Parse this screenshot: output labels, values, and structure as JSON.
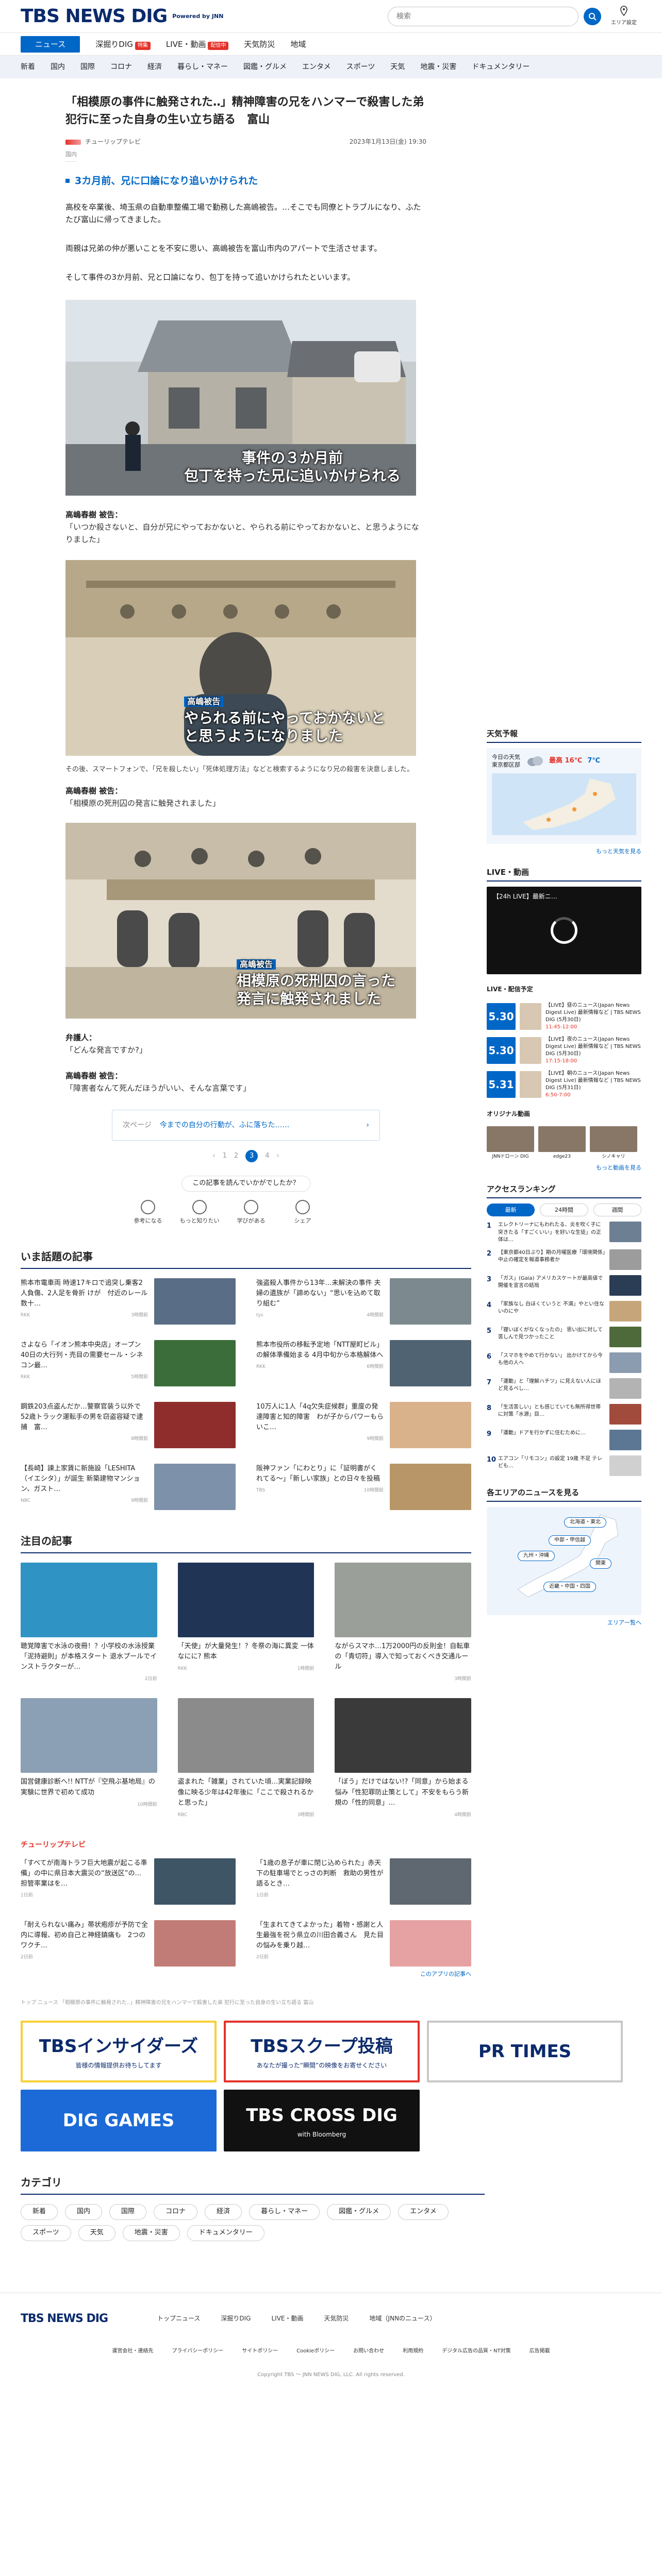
{
  "header": {
    "logo": "TBS NEWS DIG",
    "logo_sub": "Powered by JNN",
    "search_placeholder": "検索",
    "area_label": "エリア設定"
  },
  "subnav": [
    {
      "label": "ニュース",
      "active": true
    },
    {
      "label": "深掘りDIG",
      "badge": "特集"
    },
    {
      "label": "LIVE・動画",
      "badge": "配信中"
    },
    {
      "label": "天気防災"
    },
    {
      "label": "地域"
    }
  ],
  "categories_nav": [
    "新着",
    "国内",
    "国際",
    "コロナ",
    "経済",
    "暮らし・マネー",
    "図鑑・グルメ",
    "エンタメ",
    "スポーツ",
    "天気",
    "地震・災害",
    "ドキュメンタリー"
  ],
  "article": {
    "title": "「相模原の事件に触発された‥」精神障害の兄をハンマーで殺害した弟　犯行に至った自身の生い立ち語る　富山",
    "source": "チューリップテレビ",
    "date": "2023年1月13日(金) 19:30",
    "category": "国内",
    "lead": "3カ月前、兄に口論になり追いかけられた",
    "p1": "高校を卒業後、埼玉県の自動車整備工場で勤務した高嶋被告。…そこでも同僚とトラブルになり、ふたたび富山に帰ってきました。",
    "p2": "両親は兄弟の仲が悪いことを不安に思い、高嶋被告を富山市内のアパートで生活させます。",
    "p3": "そして事件の3か月前、兄と口論になり、包丁を持って追いかけられたといいます。",
    "cap1": "事件の３か月前\n包丁を持った兄に追いかけられる",
    "speaker1": "高嶋春樹 被告：",
    "quote1": "「いつか殺さないと、自分が兄にやっておかないと、やられる前にやっておかないと、と思うようになりました」",
    "cap2_tag": "高嶋被告",
    "cap2": "やられる前にやっておかないと\nと思うようになりました",
    "fact": "その後、スマートフォンで、「兄を殺したい」「死体処理方法」などと検索するようになり兄の殺害を決意しました。",
    "speaker2": "高嶋春樹 被告：",
    "quote2": "「相模原の死刑囚の発言に触発されました」",
    "cap3_tag": "高嶋被告",
    "cap3": "相模原の死刑囚の言った\n発言に触発されました",
    "speaker3": "弁護人：",
    "quote3": "「どんな発言ですか?」",
    "speaker4": "高嶋春樹 被告：",
    "quote4": "「障害者なんて死んだほうがいい、そんな言葉です」",
    "related_kicker": "次ページ",
    "related_text": "今までの自分の行動が、ふに落ちた……",
    "pager": [
      "‹",
      "1",
      "2",
      "3",
      "4",
      "›"
    ],
    "pager_current": "3",
    "feedback_q": "この記事を読んでいかがでしたか？",
    "reactions": [
      "参考になる",
      "もっと知りたい",
      "学びがある",
      "シェア"
    ]
  },
  "trending": {
    "heading": "いま話題の記事",
    "items": [
      {
        "text": "熊本市電車両 時速17キロで追突し乗客2人負傷、2人足を骨折 けが　付近のレール数十…",
        "src": "RKK",
        "time": "3時間前",
        "color": "#5a6d86"
      },
      {
        "text": "強盗殺人事件から13年…未解決の事件 夫婦の遺族が「諦めない」“思いを込めて取り組む”",
        "src": "tys",
        "time": "4時間前",
        "color": "#7c8a8f"
      },
      {
        "text": "さよなら「イオン熊本中央店」オープン40日の大行列・売目の需要セール・シネコン最…",
        "src": "RKK",
        "time": "5時間前",
        "color": "#3b6d3a"
      },
      {
        "text": "熊本市役所の移転予定地「NTT屋町ビル」の解体準備始まる 4月中旬から本格解体へ",
        "src": "RKK",
        "time": "6時間前",
        "color": "#506372"
      },
      {
        "text": "鋼鉄203点盗んだか…警察官装う以外で 52歳トラック運転手の男を窃盗容疑で逮捕　富…",
        "src": "",
        "time": "8時間前",
        "color": "#8f2d2d"
      },
      {
        "text": "10万人に1人「4q欠失症候群」重度の発達障害と知的障害　わが子からパワーもらいこ…",
        "src": "",
        "time": "9時間前",
        "color": "#d9b28c"
      },
      {
        "text": "【長崎】諫上家賃に新施設「LESHITA（イエシタ）」が誕生 新築建物マンション、ガスト…",
        "src": "NBC",
        "time": "9時間前",
        "color": "#7d91aa"
      },
      {
        "text": "阪神ファン「にわとり」に「証明書がくれてる～」「新しい家族」との日々を投稿",
        "src": "TBS",
        "time": "10時間前",
        "color": "#b89667"
      }
    ]
  },
  "focus": {
    "heading": "注目の記事",
    "items": [
      {
        "text": "聴覚障害で水泳の夜冊！？小学校の水泳授業「泥持避則」が本格スタート 退水プールでインストラクターが…",
        "src": "",
        "time": "2日前",
        "color": "#2f93c4"
      },
      {
        "text": "「天使」が大量発生！？冬祭の海に異変 一体なにに? 熊本",
        "src": "RKK",
        "time": "1時間前",
        "color": "#203456"
      },
      {
        "text": "ながらスマホ…1万2000円の反則金！自転車の「青切符」導入で知っておくべき交通ルール",
        "src": "",
        "time": "3時間前",
        "color": "#9a9f99"
      },
      {
        "text": "国営健康診断へ!! NTTが『空飛ぶ基地局』の実験に世界で初めて成功",
        "src": "",
        "time": "10時間前",
        "color": "#8ba0b4"
      },
      {
        "text": "盗まれた「雑業」されていた頃…実業記録映像に映る少年は42年後に「ここで殺されるかと思った」",
        "src": "RBC",
        "time": "3時間前",
        "color": "#8b8b8b"
      },
      {
        "text": "「ぼう」だけではない!?「同意」から始まる悩み「性犯罪防止策として」不安をもらう新規の「性的同意」…",
        "src": "",
        "time": "4時間前",
        "color": "#3a3a3a"
      }
    ]
  },
  "publisher": {
    "logo": "チューリップテレビ",
    "label": "チューリップテレビ",
    "items": [
      {
        "text": "「すべてが南海トラフ巨大地震が起こる準備」の中に県日本大震災の“放送区”の…担管率業はを…",
        "time": "1日前",
        "color": "#3e5566"
      },
      {
        "text": "「1歳の息子が車に閉じ込められた」赤天下の駐車場でとっさの判断　救助の男性が語るとき…",
        "time": "1日前",
        "color": "#5f6770"
      },
      {
        "text": "「耐えられない痛み」帯状疱疹が予防で全内に導報、初め自己と神経鎮痛も　2つのワクチ…",
        "time": "2日前",
        "color": "#c27c77"
      },
      {
        "text": "「生まれてきてよかった」着物・感謝と人生最強を祝う県立の川田合義さん　見た目の悩みを乗り越…",
        "time": "2日前",
        "color": "#e6a2a2"
      }
    ],
    "more": "このアプリの記事へ"
  },
  "breadcrumb": "トップ ニュース 「相模原の事件に触発された‥」精神障害の兄をハンマーで殺害した弟 犯行に至った自身の生い立ち語る 富山",
  "banners": [
    {
      "label": "TBSインサイダーズ",
      "sub": "皆様の情報提供お待ちしてます",
      "bg": "#fff",
      "fg": "#0a2a6b",
      "border": "#f7d038"
    },
    {
      "label": "TBSスクープ投稿",
      "sub": "あなたが撮った“瞬間”の映像をお寄せください",
      "bg": "#fff",
      "fg": "#0a2a6b",
      "border": "#e4322a"
    },
    {
      "label": "PR TIMES",
      "sub": "",
      "bg": "#fff",
      "fg": "#0a2a6b",
      "border": "#c8c8c8"
    },
    {
      "label": "DIG GAMES",
      "sub": "",
      "bg": "#1c6ad8",
      "fg": "#fff",
      "border": "#1c6ad8"
    },
    {
      "label": "TBS CROSS DIG",
      "sub": "with Bloomberg",
      "bg": "#111",
      "fg": "#fff",
      "border": "#111"
    }
  ],
  "category_heading": "カテゴリ",
  "category_chips": [
    "新着",
    "国内",
    "国際",
    "コロナ",
    "経済",
    "暮らし・マネー",
    "図鑑・グルメ",
    "エンタメ",
    "スポーツ",
    "天気",
    "地震・災害",
    "ドキュメンタリー"
  ],
  "side": {
    "weather": {
      "heading": "天気予報",
      "today": "今日の天気",
      "city": "東京都区部",
      "hi": "最高 16℃",
      "lo": "7℃",
      "more": "もっと天気を見る"
    },
    "live": {
      "heading": "LIVE・動画",
      "live_tag": "【24h LIVE】最新ニ…"
    },
    "schedule": {
      "heading": "LIVE・配信予定",
      "items": [
        {
          "date": "5.30",
          "text": "【LIVE】昼のニュース(Japan News Digest Live) 最新情報など | TBS NEWS DIG (5月30日)",
          "time": "11:45-12:00"
        },
        {
          "date": "5.30",
          "text": "【LIVE】夜のニュース(Japan News Digest Live) 最新情報など | TBS NEWS DIG (5月30日)",
          "time": "17:15-18:00"
        },
        {
          "date": "5.31",
          "text": "【LIVE】朝のニュース(Japan News Digest Live) 最新情報など | TBS NEWS DIG (5月31日)",
          "time": "6:50-7:00"
        }
      ]
    },
    "original": {
      "heading": "オリジナル動画",
      "items": [
        "JNNドローン DIG",
        "edge23",
        "シノキャリ"
      ],
      "more": "もっと動画を見る"
    },
    "ranking": {
      "heading": "アクセスランキング",
      "tabs": [
        "最新",
        "24時間",
        "週間"
      ],
      "items": [
        {
          "n": "1",
          "text": "エレクトリーナにもわれたる、炎を吹く子に突きたる「すごくいい」を好いな生徒」の正体は…"
        },
        {
          "n": "2",
          "text": "【東京都40日ぶり】期の月曜医療「環境関係」中止の確定を報道事務者か"
        },
        {
          "n": "3",
          "text": "「ガス」(Gaia) アメリカスケートが最高値で開催を宣言の結局"
        },
        {
          "n": "4",
          "text": "「家族なし 白ほくていうと 不満」やとい住ないのにや"
        },
        {
          "n": "5",
          "text": "「寝いぼくがなくなったの」 思い出に対して苦しんで見つかったこと"
        },
        {
          "n": "6",
          "text": "「スマホをやめて行かない」 出かけてから今も他の人へ"
        },
        {
          "n": "7",
          "text": "「運動」と「理解ハチツ」に見えない人にほど見るべし…"
        },
        {
          "n": "8",
          "text": "「生活苦しい」とも感じていても無所得世帯に対策「水源」目…"
        },
        {
          "n": "9",
          "text": "「運動」ドアを行かずに住むために…"
        },
        {
          "n": "10",
          "text": "エアコン「リモコン」の設定 19歳 不足 テレビも…"
        }
      ]
    },
    "area": {
      "heading": "各エリアのニュースを見る",
      "pills": [
        "北海道・東北",
        "中部・甲信越",
        "九州・沖縄",
        "関東",
        "近畿・中国・四国"
      ],
      "more": "エリア一覧へ"
    }
  },
  "footer": {
    "logo": "TBS NEWS DIG",
    "links": [
      "トップニュース",
      "深掘りDIG",
      "LIVE・動画",
      "天気防災",
      "地域（JNNのニュース）"
    ],
    "small": [
      "運営会社・連絡先",
      "プライバシーポリシー",
      "サイトポリシー",
      "Cookieポリシー",
      "お問い合わせ",
      "利用規約",
      "デジタル広告の品質・NT対策",
      "広告掲載"
    ],
    "copy": "Copyright TBS ～ JNN NEWS DIG, LLC. All rights reserved."
  }
}
